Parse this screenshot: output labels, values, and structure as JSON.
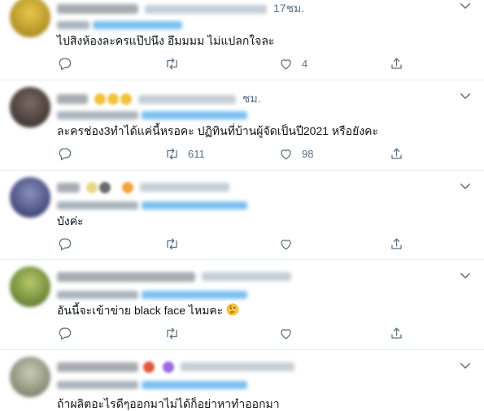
{
  "tweets": [
    {
      "time": "17ชม.",
      "text": "ไปสิงห้องละครแป๊ปนึง อึมมมม ไม่แปลกใจละ",
      "replies": "",
      "retweets": "",
      "likes": "4",
      "avatar_color": "#c9a227"
    },
    {
      "time": "ชม.",
      "text": "ละครช่อง3ทำได้แค่นี้หรอคะ ปฏิทินที่บ้านผู้จัดเป็นปี2021 หรือยังคะ",
      "replies": "",
      "retweets": "611",
      "likes": "98",
      "avatar_color": "#5a4a44"
    },
    {
      "time": "",
      "text": "บังค่ะ",
      "replies": "",
      "retweets": "",
      "likes": "",
      "avatar_color": "#3b4a7a"
    },
    {
      "time": "",
      "text": "อันนี้จะเข้าข่าย black face ไหมคะ",
      "emoji": "thinking-face",
      "replies": "",
      "retweets": "",
      "likes": "",
      "avatar_color": "#6f8f3a"
    },
    {
      "time": "",
      "text": "ถ้าผลิตอะไรดีๆออกมาไม่ได้ก็อย่าหาทำออกมา",
      "avatar_color": "#9aa08a"
    }
  ],
  "icons": {
    "reply": "reply-icon",
    "retweet": "retweet-icon",
    "like": "like-icon",
    "share": "share-icon",
    "more": "chevron-down-icon"
  },
  "colors": {
    "icon_gray": "#5b7083",
    "text": "#0f1419",
    "divider": "#e6ecf0",
    "link_blue": "#1da1f2"
  }
}
